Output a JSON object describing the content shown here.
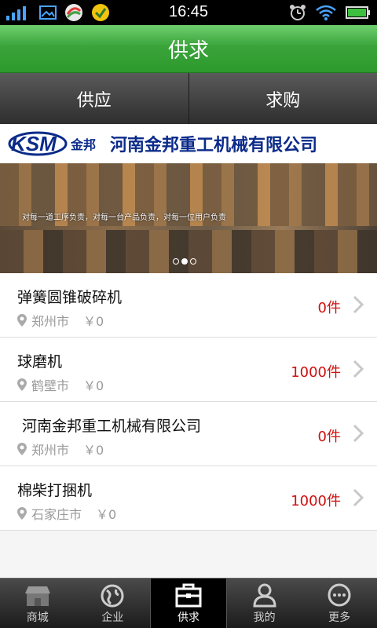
{
  "status_bar": {
    "time": "16:45"
  },
  "header": {
    "title": "供求"
  },
  "tabs": [
    {
      "label": "供应",
      "active": false
    },
    {
      "label": "求购",
      "active": true
    }
  ],
  "banner": {
    "logo_text": "KSM金邦",
    "company": "河南金邦重工机械有限公司",
    "slogan": "对每一道工序负责，对每一台产品负责，对每一位用户负责",
    "slide_index": 2,
    "slide_count": 3
  },
  "items": [
    {
      "name": "弹簧圆锥破碎机",
      "city": "郑州市",
      "price": "￥0",
      "count": "0件"
    },
    {
      "name": "球磨机",
      "city": "鹤壁市",
      "price": "￥0",
      "count": "1000件"
    },
    {
      "name": " 河南金邦重工机械有限公司",
      "city": "郑州市",
      "price": "￥0",
      "count": "0件"
    },
    {
      "name": "棉柴打捆机",
      "city": "石家庄市",
      "price": "￥0",
      "count": "1000件"
    }
  ],
  "bottom_nav": [
    {
      "label": "商城",
      "icon": "shop-icon",
      "active": false
    },
    {
      "label": "企业",
      "icon": "globe-icon",
      "active": false
    },
    {
      "label": "供求",
      "icon": "briefcase-icon",
      "active": true
    },
    {
      "label": "我的",
      "icon": "person-icon",
      "active": false
    },
    {
      "label": "更多",
      "icon": "more-icon",
      "active": false
    }
  ],
  "colors": {
    "header_green": "#3aa43a",
    "count_red": "#d01010"
  }
}
